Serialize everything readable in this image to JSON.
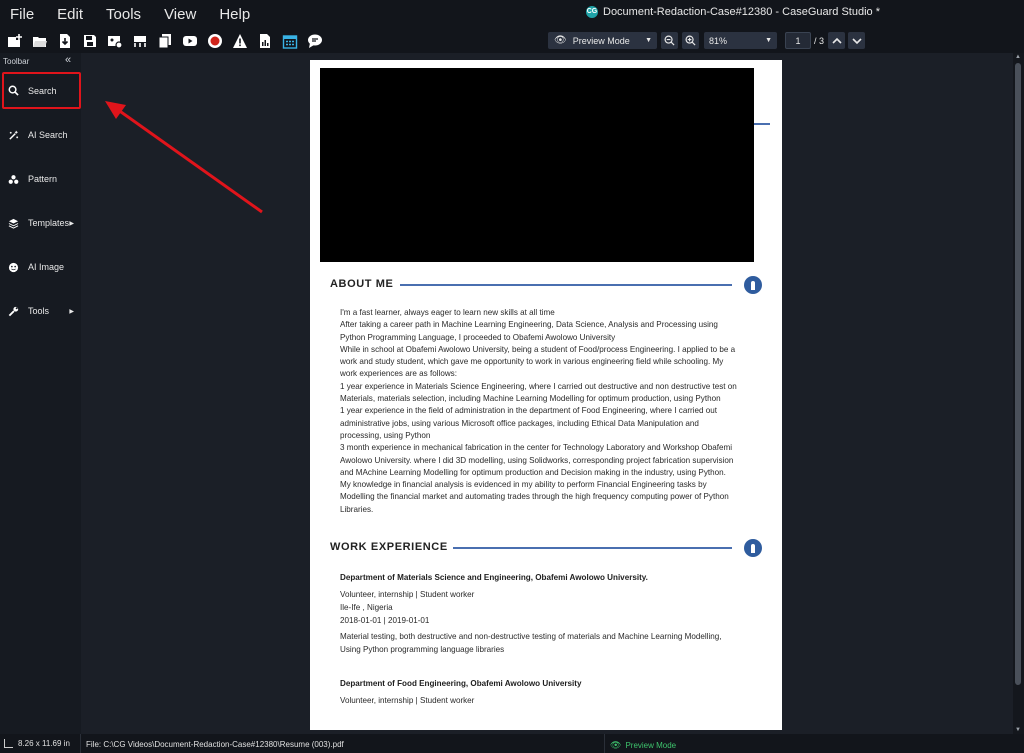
{
  "menu": [
    "File",
    "Edit",
    "Tools",
    "View",
    "Help"
  ],
  "window_title": "Document-Redaction-Case#12380 - CaseGuard Studio *",
  "toolbar": {
    "icons": [
      "new-project-icon",
      "open-folder-icon",
      "import-file-icon",
      "save-icon",
      "media-settings-icon",
      "transcribe-icon",
      "copy-file-icon",
      "youtube-icon",
      "record-icon",
      "warning-icon",
      "report-icon",
      "calendar-icon",
      "chat-icon"
    ],
    "preview_mode": "Preview Mode",
    "zoom": "81%",
    "page_current": "1",
    "page_total": "/ 3"
  },
  "sidebar": {
    "header": "Toolbar",
    "items": [
      {
        "label": "Search",
        "icon": "search-icon",
        "submenu": false
      },
      {
        "label": "AI Search",
        "icon": "ai-search-icon",
        "submenu": false
      },
      {
        "label": "Pattern",
        "icon": "pattern-icon",
        "submenu": false
      },
      {
        "label": "Templates",
        "icon": "templates-icon",
        "submenu": true
      },
      {
        "label": "AI Image",
        "icon": "ai-image-icon",
        "submenu": false
      },
      {
        "label": "Tools",
        "icon": "wrench-icon",
        "submenu": true
      }
    ]
  },
  "document": {
    "about": {
      "heading": "ABOUT ME",
      "lines": [
        "I'm a fast learner, always eager to learn new skills at all time",
        "After taking a career path in Machine Learning Engineering, Data Science, Analysis and Processing using",
        "Python Programming Language, I proceeded to Obafemi Awolowo University",
        "While in school at Obafemi Awolowo University, being a student of Food/process Engineering. I applied to be a",
        "work and study student, which gave me opportunity to work in various engineering field while schooling. My",
        "work experiences are as follows:",
        "1 year experience in Materials Science Engineering, where I carried out destructive and non destructive test on",
        "Materials, materials selection, including Machine Learning Modelling for optimum production, using Python",
        "1 year experience in the field of administration in the department of Food Engineering, where I carried out",
        "administrative jobs, using various Microsoft office packages, including Ethical Data Manipulation and",
        "processing, using Python",
        "3 month experience in mechanical fabrication in the center for Technology Laboratory and Workshop Obafemi",
        "Awolowo University. where I did 3D modelling, using Solidworks, corresponding project fabrication supervision",
        "and MAchine Learning Modelling for optimum production and Decision making in the industry, using Python.",
        "My knowledge in financial analysis is evidenced in my ability to perform Financial Engineering tasks by",
        "Modelling the financial market and automating trades through the high frequency computing power of Python",
        "Libraries."
      ]
    },
    "work": {
      "heading": "WORK EXPERIENCE",
      "job1": {
        "title": "Department of Materials Science and Engineering, Obafemi Awolowo University.",
        "role": "Volunteer, internship | Student worker",
        "location": "Ile-Ife , Nigeria",
        "dates": "2018-01-01 | 2019-01-01",
        "desc1": "Material testing, both destructive and non-destructive testing of materials and Machine Learning Modelling,",
        "desc2": "Using Python programming language libraries"
      },
      "job2": {
        "title": "Department of Food Engineering, Obafemi Awolowo University",
        "role": "Volunteer, internship | Student worker"
      }
    }
  },
  "status": {
    "page_size": "8.26 x 11.69 in",
    "file": "File: C:\\CG Videos\\Document-Redaction-Case#12380\\Resume (003).pdf",
    "mode": "Preview Mode"
  },
  "colors": {
    "accent_red": "#e0141b",
    "section_blue": "#2f5c9e",
    "status_green": "#3ec46d"
  }
}
